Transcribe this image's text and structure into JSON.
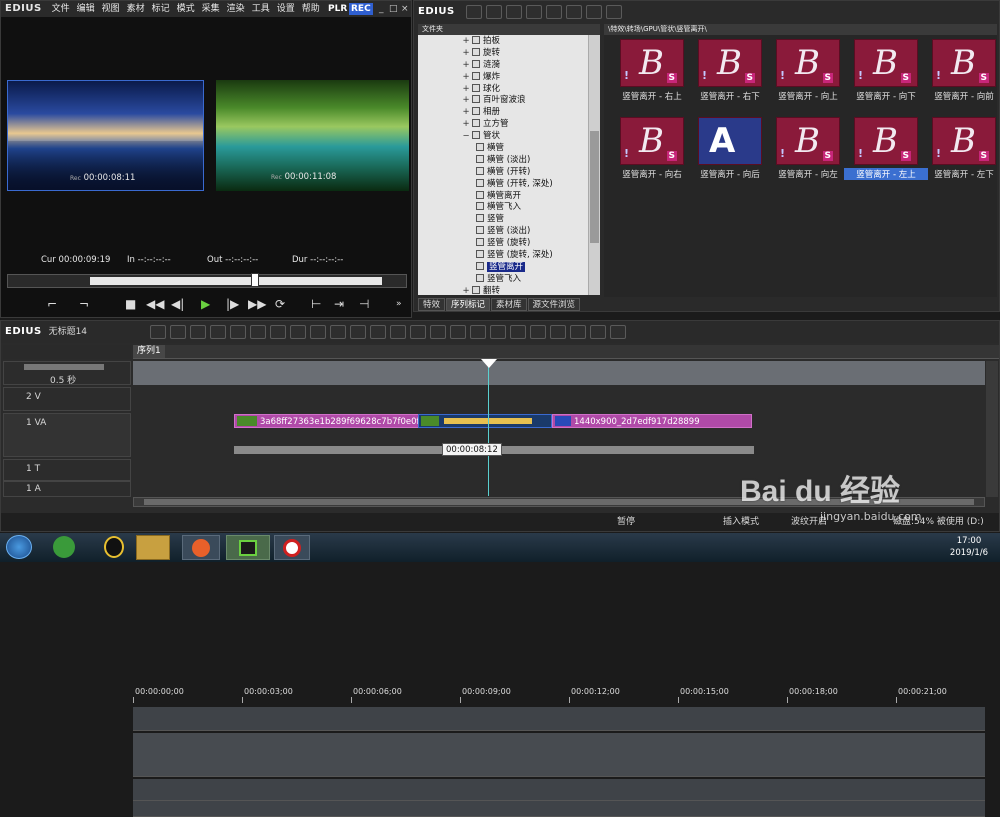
{
  "app": {
    "logo": "EDIUS"
  },
  "menu": [
    "文件",
    "编辑",
    "视图",
    "素材",
    "标记",
    "模式",
    "采集",
    "渲染",
    "工具",
    "设置",
    "帮助"
  ],
  "player": {
    "plr": "PLR",
    "rec": "REC",
    "tc_left": "00:00:08:11",
    "tc_right": "00:00:11:08",
    "tc_prefix_left": "Rec",
    "tc_prefix_right": "Rec",
    "cur_label": "Cur",
    "cur": "00:00:09:19",
    "in_label": "In",
    "in": "--:--:--:--",
    "out_label": "Out",
    "out": "--:--:--:--",
    "dur_label": "Dur",
    "dur": "--:--:--:--"
  },
  "browser": {
    "logo": "EDIUS",
    "folder_header": "文件夹",
    "path": "\\特效\\转场\\GPU\\管状\\竖管离开\\"
  },
  "tree": [
    {
      "label": "拍板",
      "exp": "+"
    },
    {
      "label": "旋转",
      "exp": "+"
    },
    {
      "label": "涟漪",
      "exp": "+"
    },
    {
      "label": "爆炸",
      "exp": "+"
    },
    {
      "label": "球化",
      "exp": "+"
    },
    {
      "label": "百叶窗波浪",
      "exp": "+"
    },
    {
      "label": "相册",
      "exp": "+"
    },
    {
      "label": "立方管",
      "exp": "+"
    },
    {
      "label": "管状",
      "exp": "−"
    },
    {
      "label": "横管",
      "sub": true
    },
    {
      "label": "横管 (淡出)",
      "sub": true
    },
    {
      "label": "横管 (开转)",
      "sub": true
    },
    {
      "label": "横管 (开转, 深处)",
      "sub": true
    },
    {
      "label": "横管离开",
      "sub": true
    },
    {
      "label": "横管飞入",
      "sub": true
    },
    {
      "label": "竖管",
      "sub": true
    },
    {
      "label": "竖管 (淡出)",
      "sub": true
    },
    {
      "label": "竖管 (旋转)",
      "sub": true
    },
    {
      "label": "竖管 (旋转, 深处)",
      "sub": true
    },
    {
      "label": "竖管离开",
      "sub": true,
      "selected": true
    },
    {
      "label": "竖管飞入",
      "sub": true
    },
    {
      "label": "翻转",
      "exp": "+"
    }
  ],
  "thumbs": [
    {
      "label": "竖管离开 - 右上"
    },
    {
      "label": "竖管离开 - 右下"
    },
    {
      "label": "竖管离开 - 向上"
    },
    {
      "label": "竖管离开 - 向下"
    },
    {
      "label": "竖管离开 - 向前"
    },
    {
      "label": "竖管离开 - 向右"
    },
    {
      "label": "竖管离开 - 向后",
      "alt": true
    },
    {
      "label": "竖管离开 - 向左"
    },
    {
      "label": "竖管离开 - 左上",
      "selected": true
    },
    {
      "label": "竖管离开 - 左下"
    }
  ],
  "bottom_tabs": [
    "特效",
    "序列标记",
    "素材库",
    "源文件浏览"
  ],
  "timeline": {
    "logo": "EDIUS",
    "project": "无标题14",
    "sequence_tab": "序列1",
    "zoom": "0.5 秒",
    "ruler": [
      "00:00:00;00",
      "00:00:03;00",
      "00:00:06;00",
      "00:00:09;00",
      "00:00:12;00",
      "00:00:15;00",
      "00:00:18;00",
      "00:00:21;00"
    ],
    "tracks": {
      "v2": "2 V",
      "va1": "1 VA",
      "t1": "1 T",
      "a1": "1 A"
    },
    "clip1": "3a68ff27363e1b289f69628c7b7f0e0f",
    "clip2": "1440x900_2d7edf917d28899",
    "tooltip": "00:00:08:12"
  },
  "status": {
    "pause": "暂停",
    "insert": "插入模式",
    "ripple": "波纹开启",
    "disk": "磁盘:54% 被使用 (D:)"
  },
  "taskbar": {
    "time": "17:00",
    "date": "2019/1/6"
  },
  "watermark": {
    "brand": "Bai du 经验",
    "url": "jingyan.baidu.com"
  }
}
